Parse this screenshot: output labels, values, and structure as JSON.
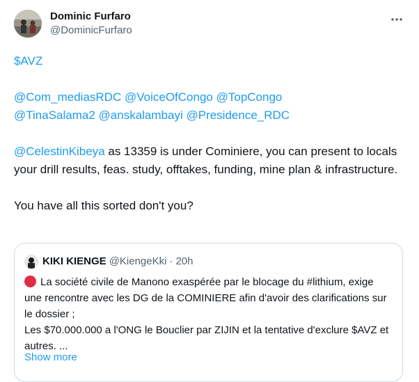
{
  "author": {
    "display_name": "Dominic Furfaro",
    "handle": "@DominicFurfaro"
  },
  "tweet": {
    "cashtag": "$AVZ",
    "mentions_line1": [
      "@Com_mediasRDC",
      "@VoiceOfCongo",
      "@TopCongo"
    ],
    "mentions_line2": [
      "@TinaSalama2",
      "@anskalambayi",
      "@Presidence_RDC"
    ],
    "para_mention": "@CelestinKibeya",
    "para_text": " as 13359 is under Cominiere, you can present to locals your drill results, feas. study, offtakes, funding, mine plan & infrastructure.",
    "closing": "You have all this sorted don't you?"
  },
  "quote": {
    "display_name": "KIKI KIENGE",
    "handle": "@KiengeKki",
    "separator": "·",
    "time": "20h",
    "emoji": "red-circle",
    "line1": "La société civile de Manono exaspérée par le blocage du #lithium, exige une rencontre avec les DG de la COMINIERE afin d'avoir des clarifications sur le dossier ;",
    "line2": "Les $70.000.000 a l'ONG le Bouclier par ZIJIN et la tentative d'exclure $AVZ et autres. ...",
    "show_more": "Show more"
  },
  "colors": {
    "link": "#1d9bf0",
    "text": "#0f1419",
    "secondary": "#536471",
    "border": "#cfd9de",
    "red_circle": "#dd2e44"
  },
  "icons": {
    "more": "more-horizontal-icon"
  }
}
